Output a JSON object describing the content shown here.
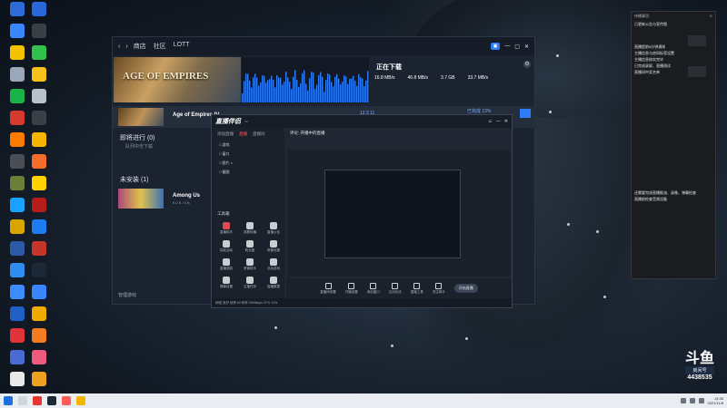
{
  "desktop": {
    "icons": [
      {
        "label": "",
        "color": "#2d6bd6"
      },
      {
        "label": "",
        "color": "#3a86ff"
      },
      {
        "label": "",
        "color": "#f2c200"
      },
      {
        "label": "",
        "color": "#9aa7b8"
      },
      {
        "label": "",
        "color": "#19b34a"
      },
      {
        "label": "",
        "color": "#d53a2f"
      },
      {
        "label": "",
        "color": "#ff7b00"
      },
      {
        "label": "",
        "color": "#4b4f55"
      },
      {
        "label": "",
        "color": "#6b7f3a"
      },
      {
        "label": "",
        "color": "#1aa1ff"
      },
      {
        "label": "",
        "color": "#d8a400"
      },
      {
        "label": "",
        "color": "#2c5aa8"
      },
      {
        "label": "",
        "color": "#2f8df0"
      },
      {
        "label": "",
        "color": "#3c8cff"
      },
      {
        "label": "",
        "color": "#1f5fc7"
      },
      {
        "label": "",
        "color": "#e1343a"
      },
      {
        "label": "",
        "color": "#4a6bd1"
      },
      {
        "label": "",
        "color": "#e9e9e9"
      },
      {
        "label": "",
        "color": "#2a67d8"
      },
      {
        "label": "",
        "color": "#3b3f46"
      },
      {
        "label": "",
        "color": "#31c24d"
      },
      {
        "label": "",
        "color": "#f6c21a"
      },
      {
        "label": "",
        "color": "#b8c2cc"
      },
      {
        "label": "",
        "color": "#3b3f46"
      },
      {
        "label": "",
        "color": "#f4b400"
      },
      {
        "label": "",
        "color": "#f56b2a"
      },
      {
        "label": "",
        "color": "#ffd200"
      },
      {
        "label": "",
        "color": "#b71c1c"
      },
      {
        "label": "",
        "color": "#1d7cf2"
      },
      {
        "label": "",
        "color": "#c5352a"
      },
      {
        "label": "",
        "color": "#1b2838"
      },
      {
        "label": "",
        "color": "#3a86ff"
      },
      {
        "label": "",
        "color": "#f2a900"
      },
      {
        "label": "",
        "color": "#f57b20"
      },
      {
        "label": "",
        "color": "#f05a7e"
      },
      {
        "label": "",
        "color": "#f0a020"
      }
    ]
  },
  "client": {
    "tabs": [
      "商店",
      "社区",
      "LOTT"
    ],
    "hero_title": "AGE OF EMPIRES",
    "download_title": "正在下载",
    "stats": [
      {
        "value": "16.8 MB/s",
        "label": ""
      },
      {
        "value": "46.8 MB/s",
        "label": ""
      },
      {
        "value": "3.7 GB",
        "label": ""
      },
      {
        "value": "33.7 MB/s",
        "label": ""
      }
    ],
    "current_game": "Age of Empires IV",
    "current_time": "12:3 11",
    "current_percent": "已完成 13%",
    "progress_fraction": 0.13,
    "section_in_progress": "即将进行 (0)",
    "section_in_progress_sub": "队列中无下载",
    "section_uninstalled": "未安装 (1)",
    "second_game": "Among Us",
    "second_game_size": "0.0 B / 0 B",
    "bottom_label": "管理游戏"
  },
  "obs": {
    "app_name": "直播伴侣",
    "version": "",
    "side_tabs": [
      "添加直播",
      "直播",
      "直播间"
    ],
    "sources": [
      "□ 游戏",
      "□ 窗口",
      "□ 图片 ×",
      "□ 截图"
    ],
    "tools_title": "工具箱",
    "tools": [
      "直播助手",
      "观看转播",
      "直播公告",
      "抽奖活动",
      "粉丝团",
      "房管设置",
      "直播录制",
      "房管助手",
      "互动游戏",
      "弹幕设置",
      "主播任务",
      "直播数据"
    ],
    "header": "评论: 开播中的直播",
    "bottom_buttons": [
      "直播间设置",
      "开播设置",
      "添加窗口",
      "互动玩法",
      "直播工具",
      "关注助手"
    ],
    "start_label": "开始直播",
    "status": "网络 良好 帧率 60 码率 3000kbps CPU 12%"
  },
  "notes": {
    "title": "待播事项",
    "lines": [
      "已更新公告与宣传图",
      "",
      "",
      "",
      "直播提前5分钟通知",
      "主播信息与房间标签设置",
      "主播信息核实完毕",
      "已完成录屏、直播测试",
      "直播间中奖名单"
    ],
    "lines2": [
      "还需要完成直播推流、录像、弹幕检查",
      "直播前检查音频设备"
    ]
  },
  "badge": {
    "brand": "斗鱼",
    "room_label": "房间号",
    "room_number": "4438535"
  },
  "taskbar": {
    "time": "14:35",
    "date": "2021/11/8"
  }
}
